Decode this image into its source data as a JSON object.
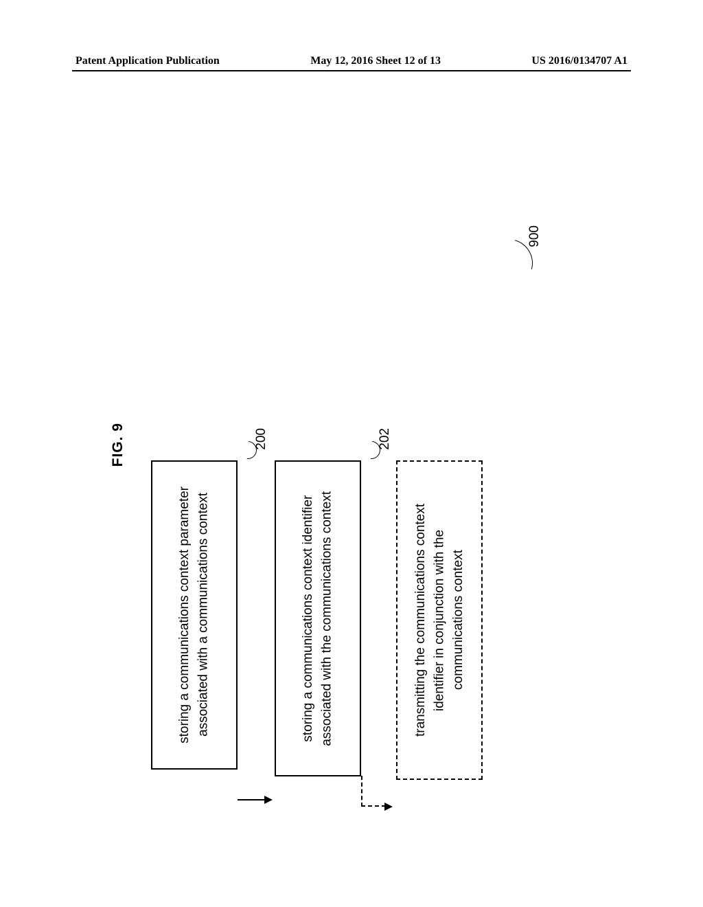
{
  "header": {
    "left": "Patent Application Publication",
    "center": "May 12, 2016  Sheet 12 of 13",
    "right": "US 2016/0134707 A1"
  },
  "figure": {
    "label": "FIG. 9",
    "box200": {
      "text": "storing a communications context parameter\nassociated with a communications context",
      "ref": "200"
    },
    "box202": {
      "text": "storing a communications context identifier\nassociated with the communications context",
      "ref": "202"
    },
    "box900": {
      "text": "transmitting the communications context\nidentifier in conjunction with the\ncommunications context",
      "ref": "900"
    }
  }
}
